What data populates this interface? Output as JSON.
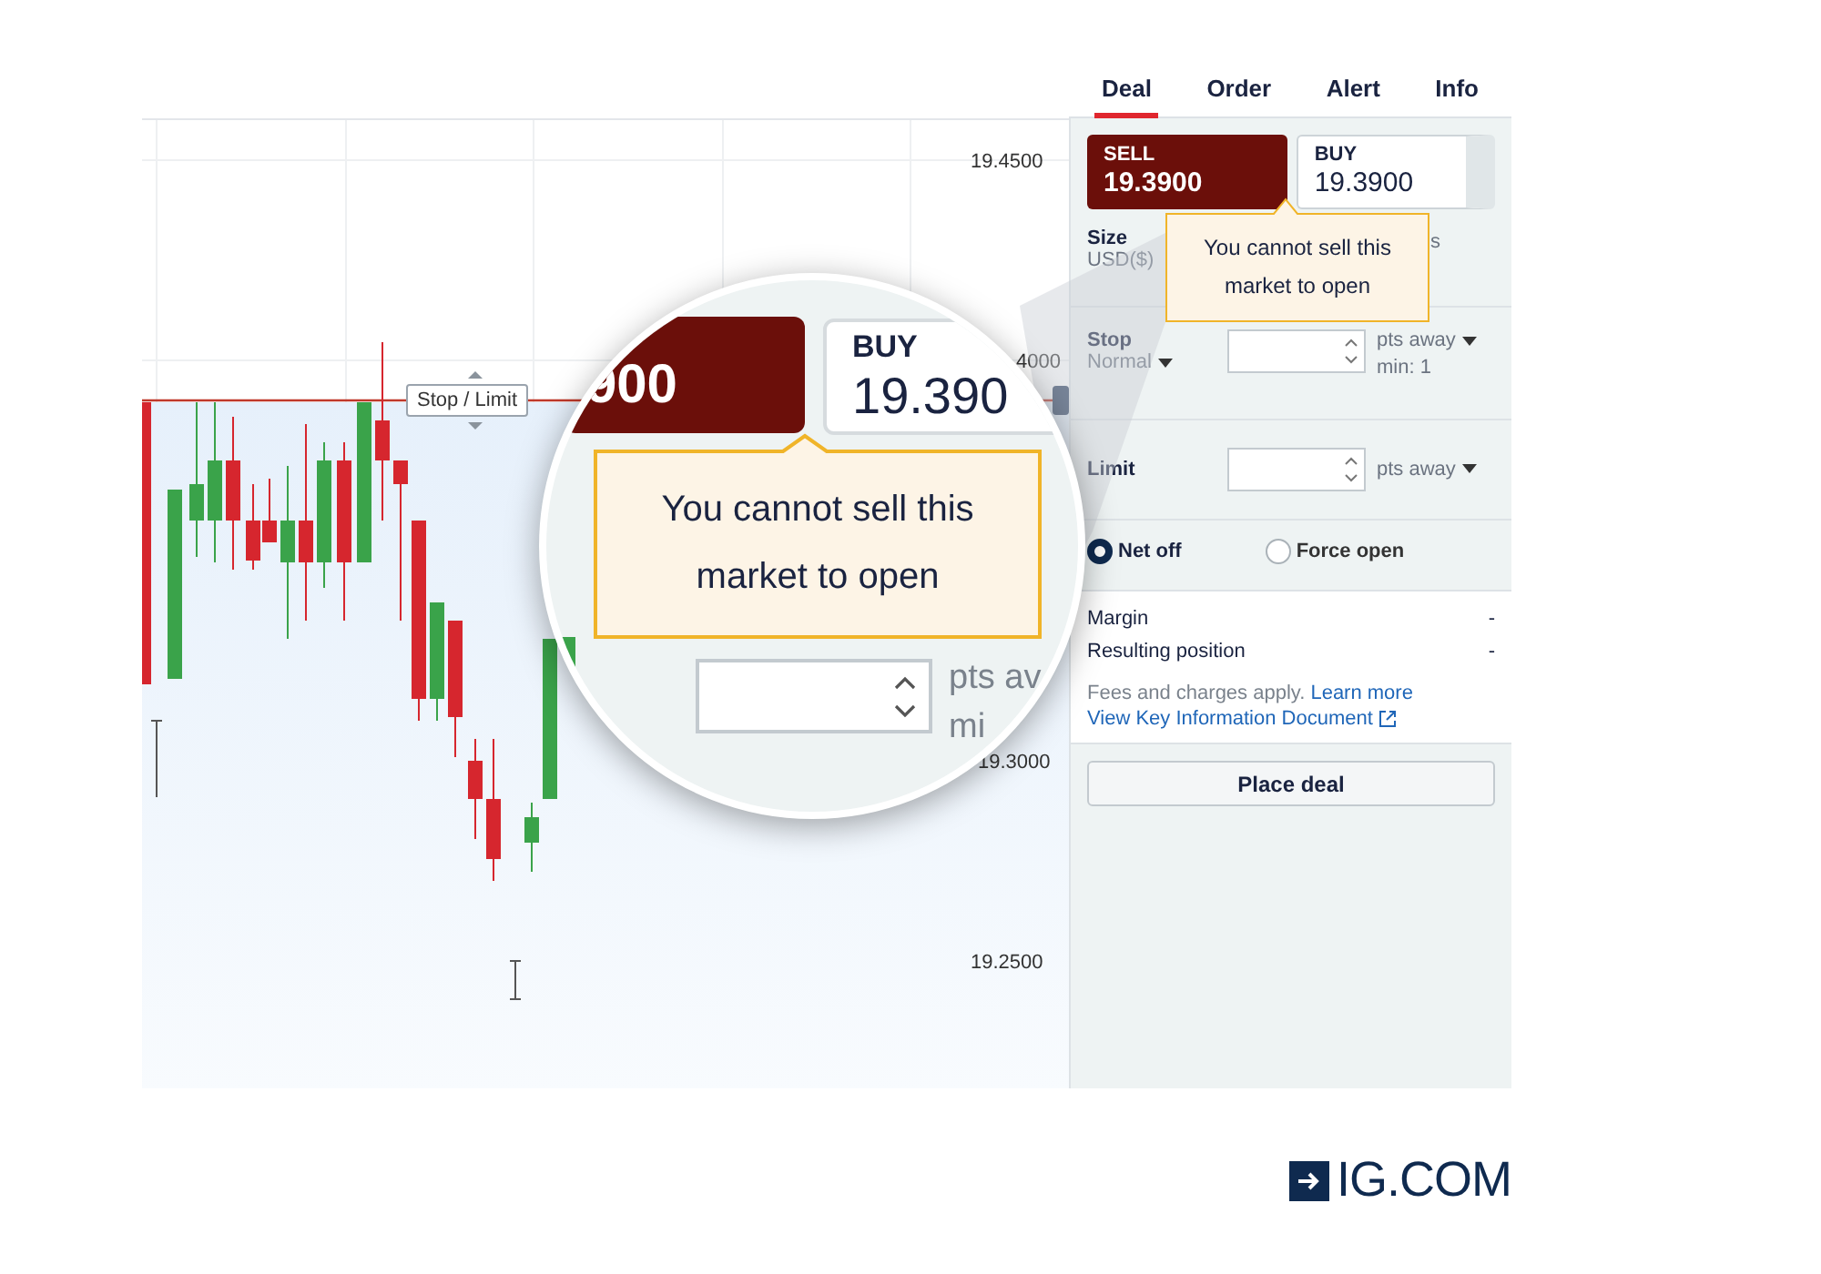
{
  "chart": {
    "price_labels": [
      {
        "text": "19.4500"
      },
      {
        "text": "4000"
      },
      {
        "text": "19.3000"
      },
      {
        "text": "19.2500"
      }
    ],
    "order_line_label": "Stop / Limit"
  },
  "tabs": [
    {
      "label": "Deal",
      "selected": true
    },
    {
      "label": "Order",
      "selected": false
    },
    {
      "label": "Alert",
      "selected": false
    },
    {
      "label": "Info",
      "selected": false
    }
  ],
  "sell": {
    "label": "SELL",
    "price": "19.3900"
  },
  "buy": {
    "label": "BUY",
    "price": "19.3900"
  },
  "tooltip": "You cannot sell this market to open",
  "size": {
    "label": "Size",
    "unit": "USD($)",
    "trailing": "s"
  },
  "stop": {
    "label": "Stop",
    "type": "Normal",
    "unit": "pts away",
    "hint": "min: 1"
  },
  "limit": {
    "label": "Limit",
    "unit": "pts away"
  },
  "position_mode": [
    {
      "label": "Net off",
      "selected": true
    },
    {
      "label": "Force open",
      "selected": false
    }
  ],
  "summary": [
    {
      "label": "Margin",
      "value": "-"
    },
    {
      "label": "Resulting position",
      "value": "-"
    }
  ],
  "fees_note": "Fees and charges apply.",
  "fees_link": "Learn more",
  "kid_link": "View Key Information Document",
  "place_deal": "Place deal",
  "magnifier": {
    "sell_price_part": "900",
    "buy_label": "BUY",
    "buy_price_part": "19.390",
    "tooltip": "You cannot sell this market to open",
    "unit_part": "pts av",
    "hint_part": "mi"
  },
  "brand": "IG.COM"
}
